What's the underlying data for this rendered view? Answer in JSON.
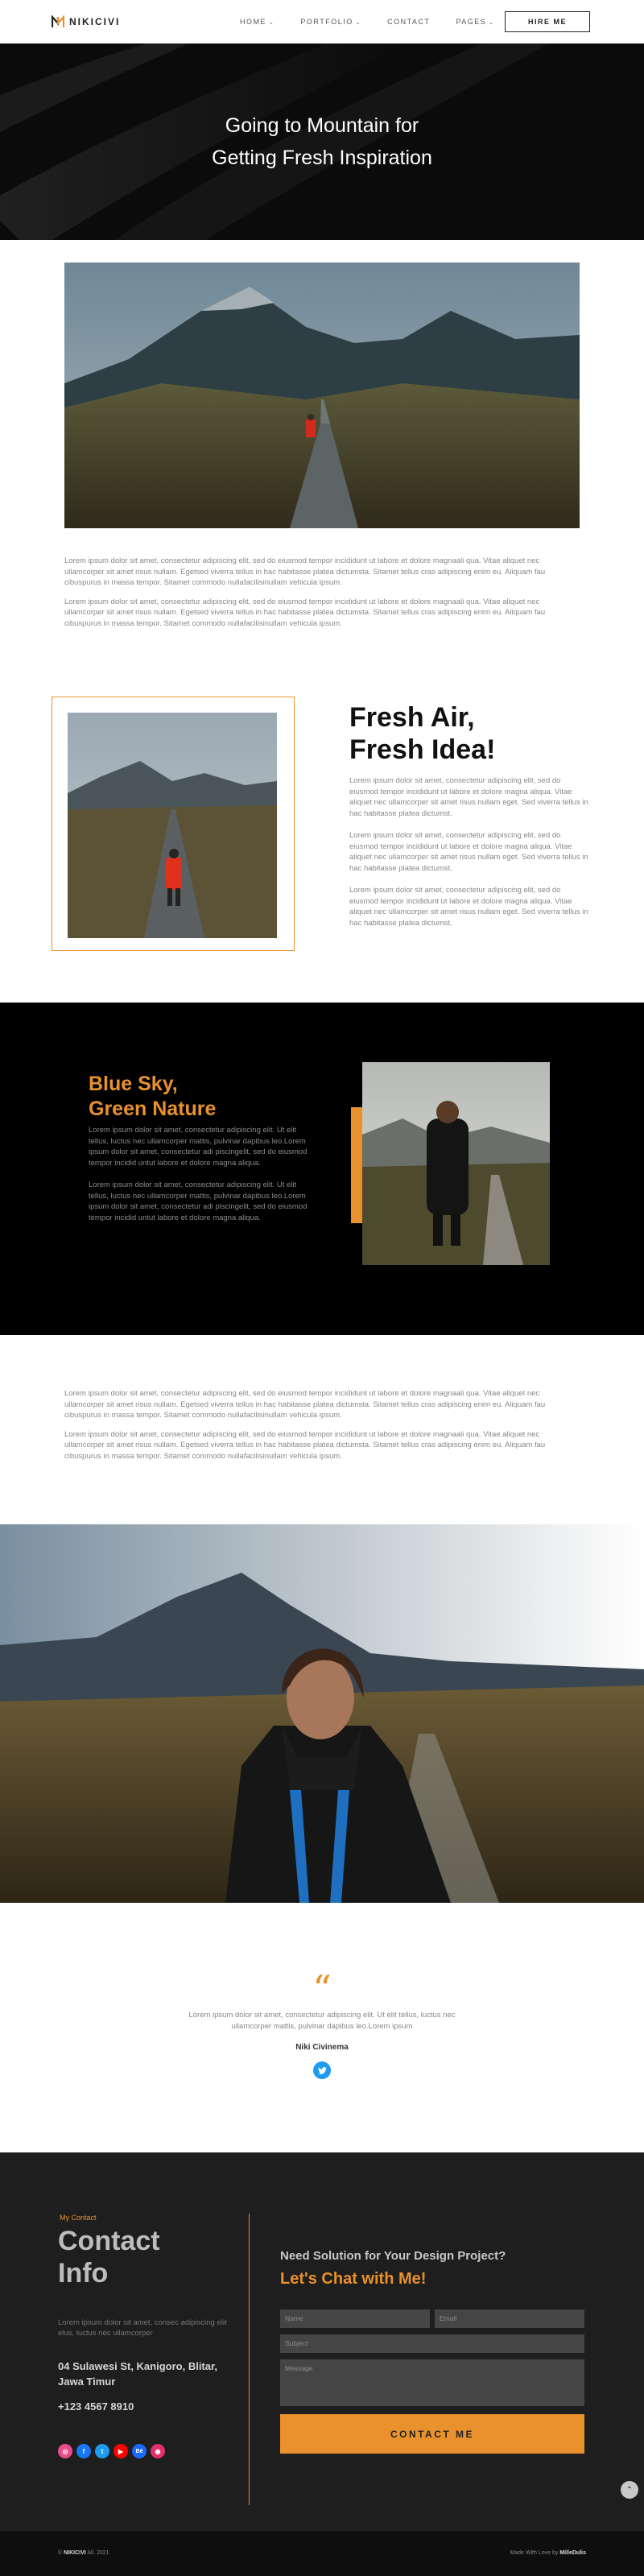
{
  "brand": {
    "name": "NIKICIVI",
    "accent": "#e8912d"
  },
  "nav": {
    "items": [
      {
        "label": "HOME",
        "has_dropdown": true
      },
      {
        "label": "PORTFOLIO",
        "has_dropdown": true
      },
      {
        "label": "CONTACT",
        "has_dropdown": false
      },
      {
        "label": "PAGES",
        "has_dropdown": true
      }
    ],
    "hire_label": "HIRE ME"
  },
  "hero": {
    "line1": "Going to Mountain for",
    "line2": "Getting Fresh Inspiration"
  },
  "article": {
    "p1": "Lorem ipsum dolor sit amet, consectetur adipiscing elit, sed do eiusmod tempor incididunt ut labore et dolore magnaali qua. Vitae aliquet nec ullamcorper sit amet risus nullam. Egetsed viverra tellus in hac habitasse platea dictumsta. Sitamet tellus cras adipiscing enim eu. Aliquam fau cibuspurus in massa tempor. Sitamet commodo nullafacilisinullam vehicula ipsum.",
    "p2": "Lorem ipsum dolor sit amet, consectetur adipiscing elit, sed do eiusmod tempor incididunt ut labore et dolore magnaali qua. Vitae aliquet nec ullamcorper sit amet risus nullam. Egetsed viverra tellus in hac habitasse platea dictumsta. Sitamet tellus cras adipiscing enim eu. Aliquam fau cibuspurus in massa tempor. Sitamet commodo nullafacilisinullam vehicula ipsum."
  },
  "fresh": {
    "title_line1": "Fresh Air,",
    "title_line2": "Fresh Idea!",
    "paragraphs": [
      "Lorem ipsum dolor sit amet, consectetur adipiscing elit, sed do eiusmod tempor incididunt ut labore et dolore magna aliqua. Vitae aliquet nec ullamcorper sit amet risus nullam eget. Sed viverra tellus in hac habitasse platea dictumst.",
      "Lorem ipsum dolor sit amet, consectetur adipiscing elit, sed do eiusmod tempor incididunt ut labore et dolore magna aliqua. Vitae aliquet nec ullamcorper sit amet risus nullam eget. Sed viverra tellus in hac habitasse platea dictumst.",
      "Lorem ipsum dolor sit amet, consectetur adipiscing elit, sed do eiusmod tempor incididunt ut labore et dolore magna aliqua. Vitae aliquet nec ullamcorper sit amet risus nullam eget. Sed viverra tellus in hac habitasse platea dictumst."
    ]
  },
  "dark": {
    "title_line1": "Blue Sky,",
    "title_line2": "Green Nature",
    "paragraphs": [
      "Lorem ipsum dolor sit amet, consectetur adipiscing elit. Ut elit tellus, luctus nec ullamcorper mattis, pulvinar dapibus leo.Lorem ipsum dolor sit amet, consectetur adi piscingelit, sed do eiusmod tempor incidid untut labore et dolore magna aliqua.",
      "Lorem ipsum dolor sit amet, consectetur adipiscing elit. Ut elit tellus, luctus nec ullamcorper mattis, pulvinar dapibus leo.Lorem ipsum dolor sit amet, consectetur adi piscingelit, sed do eiusmod tempor incidid untut labore et dolore magna aliqua."
    ]
  },
  "article2": {
    "p1": "Lorem ipsum dolor sit amet, consectetur adipiscing elit, sed do eiusmod tempor incididunt ut labore et dolore magnaali qua. Vitae aliquet nec ullamcorper sit amet risus nullam. Egetsed viverra tellus in hac habitasse platea dictumsta. Sitamet tellus cras adipiscing enim eu. Aliquam fau cibuspurus in massa tempor. Sitamet commodo nullafacilisinullam vehicula ipsum.",
    "p2": "Lorem ipsum dolor sit amet, consectetur adipiscing elit, sed do eiusmod tempor incididunt ut labore et dolore magnaali qua. Vitae aliquet nec ullamcorper sit amet risus nullam. Egetsed viverra tellus in hac habitasse platea dictumsta. Sitamet tellus cras adipiscing enim eu. Aliquam fau cibuspurus in massa tempor. Sitamet commodo nullafacilisinullam vehicula ipsum."
  },
  "testimonial": {
    "quote_mark": "“",
    "text": "Lorem ipsum dolor sit amet, consectetur adipiscing elit. Ut elit tellus, luctus nec ullamcorper mattis, pulvinar dapibus leo.Lorem ipsum",
    "name": "Niki Civinema",
    "icon": "twitter-icon"
  },
  "contact": {
    "tag": "My Contact",
    "title_line1": "Contact",
    "title_line2": "Info",
    "description": "Lorem ipsum dolor sit amet, consec adipiscing elit elus, luctus nec ullamcorper",
    "address": "04 Sulawesi St, Kanigoro, Blitar, Jawa Timur",
    "phone": "+123 4567 8910",
    "socials": [
      {
        "icon": "dribbble-icon",
        "glyph": "◎",
        "color": "#ea4c89"
      },
      {
        "icon": "facebook-icon",
        "glyph": "f",
        "color": "#1877f2"
      },
      {
        "icon": "twitter-icon",
        "glyph": "t",
        "color": "#1d9bf0"
      },
      {
        "icon": "youtube-icon",
        "glyph": "▶",
        "color": "#ff0000"
      },
      {
        "icon": "behance-icon",
        "glyph": "Bē",
        "color": "#1769ff"
      },
      {
        "icon": "instagram-icon",
        "glyph": "◉",
        "color": "#e1306c"
      }
    ],
    "form_title1": "Need Solution for Your Design Project?",
    "form_title2": "Let's Chat with Me!",
    "name_placeholder": "Name",
    "email_placeholder": "Email",
    "subject_placeholder": "Subject",
    "message_placeholder": "Message",
    "button_label": "CONTACT ME",
    "scroll_top": "⌃"
  },
  "footer": {
    "copy_prefix": "©",
    "copy_brand": "NIKICIVI",
    "copy_suffix": "All. 2021",
    "made_prefix": "Made With Love by",
    "made_brand": "MilleDulis"
  }
}
